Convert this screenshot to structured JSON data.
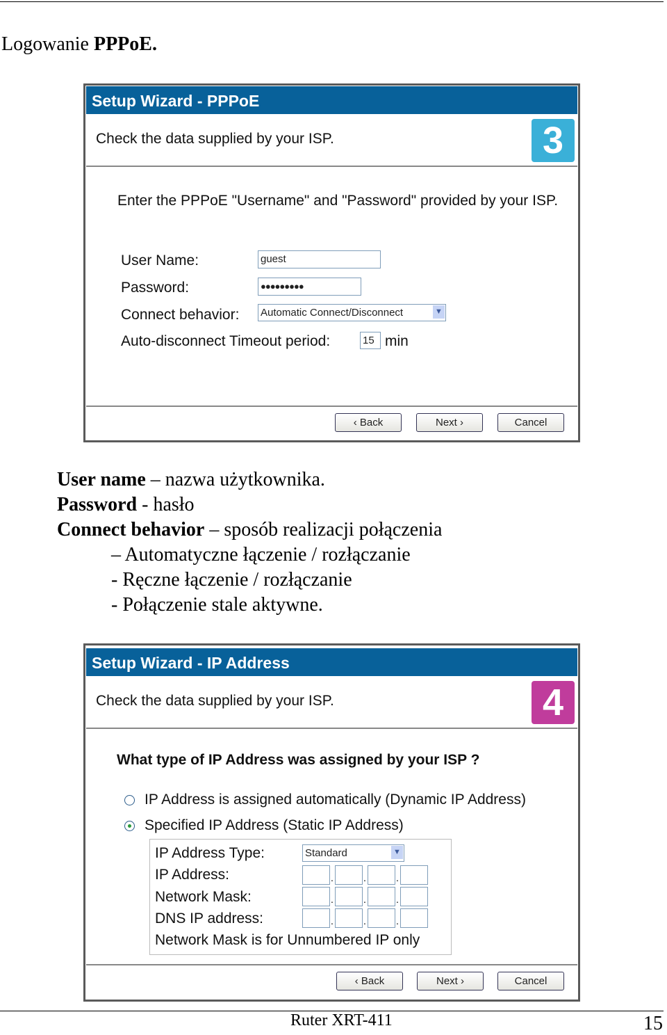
{
  "page": {
    "title_plain": "Logowanie ",
    "title_bold": "PPPoE.",
    "footer": "Ruter XRT-411",
    "page_number": "15"
  },
  "wizard1": {
    "title": "Setup Wizard - PPPoE",
    "subtitle": "Check the data supplied by your ISP.",
    "step_icon": "3",
    "icon_color": "#3ab0d8",
    "instruction": "Enter the PPPoE \"Username\" and \"Password\" provided by your ISP.",
    "user_name_label": "User Name:",
    "user_name_value": "guest",
    "password_label": "Password:",
    "password_value": "●●●●●●●●●",
    "connect_label": "Connect behavior:",
    "connect_value": "Automatic Connect/Disconnect",
    "timeout_label": "Auto-disconnect Timeout period:",
    "timeout_value": "15",
    "timeout_unit": "min",
    "back": "‹ Back",
    "next": "Next ›",
    "cancel": "Cancel"
  },
  "explanation": [
    {
      "bold": "User name",
      "text": " – nazwa użytkownika."
    },
    {
      "bold": "Password",
      "text": " - hasło"
    },
    {
      "bold": "Connect behavior",
      "text": " – sposób realizacji połączenia"
    }
  ],
  "options": [
    "– Automatyczne łączenie / rozłączanie",
    "- Ręczne łączenie / rozłączanie",
    "- Połączenie stale aktywne."
  ],
  "wizard2": {
    "title": "Setup Wizard - IP Address",
    "subtitle": "Check the data supplied by your ISP.",
    "step_icon": "4",
    "icon_color": "#c03c9c",
    "question": "What type of IP Address was assigned by your ISP ?",
    "radio_dynamic": "IP Address is assigned automatically (Dynamic IP Address)",
    "radio_static": "Specified IP Address (Static IP Address)",
    "selected": "static",
    "ip_type_label": "IP Address Type:",
    "ip_type_value": "Standard",
    "ip_label": "IP Address:",
    "mask_label": "Network Mask:",
    "dns_label": "DNS IP address:",
    "note": "Network Mask is for Unnumbered IP only",
    "back": "‹ Back",
    "next": "Next ›",
    "cancel": "Cancel"
  }
}
